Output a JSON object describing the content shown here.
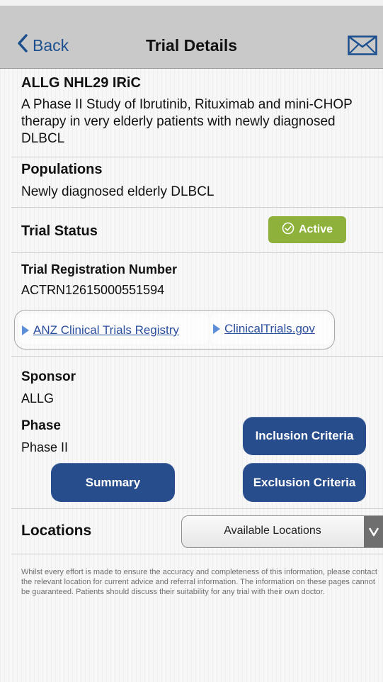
{
  "navbar": {
    "back_label": "Back",
    "title": "Trial Details",
    "mail_icon": "mail-icon"
  },
  "trial": {
    "code": "ALLG NHL29 IRiC",
    "description": "A Phase II Study of Ibrutinib, Rituximab and mini-CHOP therapy in very elderly patients with newly diagnosed DLBCL"
  },
  "populations": {
    "heading": "Populations",
    "value": "Newly diagnosed elderly DLBCL"
  },
  "status": {
    "heading": "Trial Status",
    "badge": "Active",
    "badge_color": "#8db13a"
  },
  "registration": {
    "heading": "Trial Registration Number",
    "value": "ACTRN12615000551594",
    "links": [
      "ANZ Clinical Trials Registry",
      "ClinicalTrials.gov"
    ]
  },
  "sponsor": {
    "heading": "Sponsor",
    "value": "ALLG"
  },
  "phase": {
    "heading": "Phase",
    "value": "Phase II"
  },
  "buttons": {
    "inclusion": "Inclusion Criteria",
    "summary": "Summary",
    "exclusion": "Exclusion Criteria",
    "color": "#274d8c"
  },
  "locations": {
    "heading": "Locations",
    "selected": "Available Locations"
  },
  "disclaimer": "Whilst every effort is made to ensure the accuracy and completeness of this information, please contact the relevant location for current advice and referral information. The information on these pages cannot be guaranteed. Patients should discuss their suitability for any trial with their own doctor."
}
